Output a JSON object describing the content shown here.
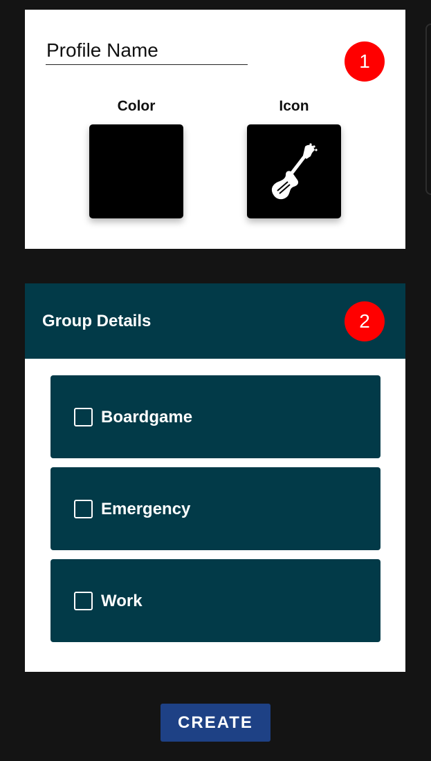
{
  "profile": {
    "name_placeholder": "Profile Name",
    "name_value": "",
    "step_badge": "1",
    "color_label": "Color",
    "icon_label": "Icon",
    "selected_color": "#000000",
    "selected_icon": "guitar-icon"
  },
  "groups": {
    "title": "Group Details",
    "step_badge": "2",
    "options": [
      {
        "label": "Boardgame",
        "checked": false
      },
      {
        "label": "Emergency",
        "checked": false
      },
      {
        "label": "Work",
        "checked": false
      }
    ]
  },
  "actions": {
    "create_label": "CREATE"
  },
  "colors": {
    "page_background": "#141414",
    "card_background": "#ffffff",
    "group_teal": "#023a48",
    "badge_red": "#ff0000",
    "create_button": "#1e4185"
  }
}
